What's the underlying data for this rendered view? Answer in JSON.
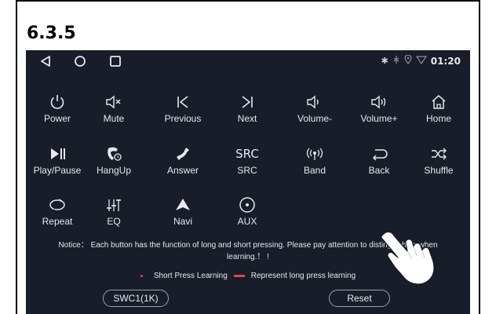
{
  "section": "6.3.5",
  "status": {
    "time": "01:20"
  },
  "buttons": [
    {
      "label": "Power",
      "icon": "power-icon"
    },
    {
      "label": "Mute",
      "icon": "mute-icon"
    },
    {
      "label": "Previous",
      "icon": "previous-icon"
    },
    {
      "label": "Next",
      "icon": "next-icon"
    },
    {
      "label": "Volume-",
      "icon": "volume-down-icon"
    },
    {
      "label": "Volume+",
      "icon": "volume-up-icon"
    },
    {
      "label": "Home",
      "icon": "home-icon"
    },
    {
      "label": "Play/Pause",
      "icon": "play-pause-icon"
    },
    {
      "label": "HangUp",
      "icon": "hangup-icon"
    },
    {
      "label": "Answer",
      "icon": "answer-icon"
    },
    {
      "label": "SRC",
      "icon": "src-icon",
      "icon_text": "SRC"
    },
    {
      "label": "Band",
      "icon": "band-icon"
    },
    {
      "label": "Back",
      "icon": "back-icon"
    },
    {
      "label": "Shuffle",
      "icon": "shuffle-icon"
    },
    {
      "label": "Repeat",
      "icon": "repeat-icon"
    },
    {
      "label": "EQ",
      "icon": "eq-icon"
    },
    {
      "label": "Navi",
      "icon": "navi-icon"
    },
    {
      "label": "AUX",
      "icon": "aux-icon"
    }
  ],
  "notice": {
    "line1": "Notice： Each button has the function of long and short pressing. Please pay attention to distinguishing when",
    "line2": "learning.！ !"
  },
  "legend": {
    "short": "Short Press Learning",
    "long": "Represent long press learning",
    "color": "#e6414f"
  },
  "footer": {
    "swc_label": "SWC1(1K)",
    "reset_label": "Reset"
  }
}
